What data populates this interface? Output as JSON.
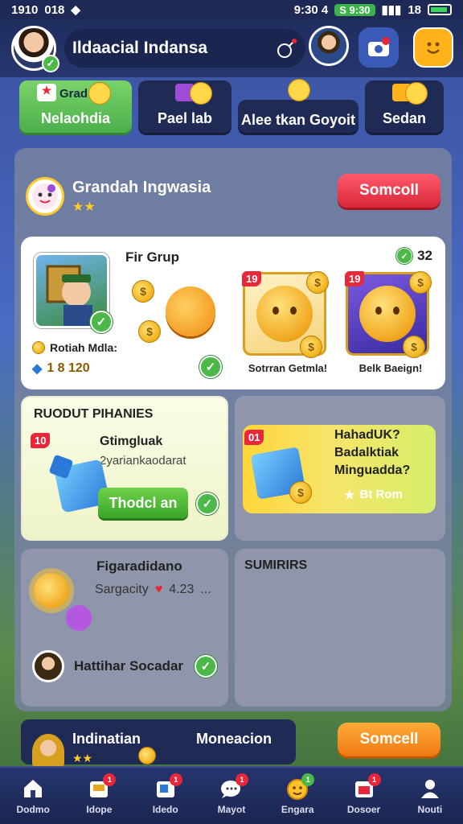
{
  "status_bar": {
    "left_time": "1910",
    "left_extra": "018",
    "center_clock": "9:30 4",
    "pill_text": "S 9:30",
    "right_extra": "18"
  },
  "header": {
    "username": "Ildaacial Indansa"
  },
  "tabs": [
    {
      "label": "Nelaohdia",
      "top_label": "Grad",
      "active": true
    },
    {
      "label": "Pael lab"
    },
    {
      "label": "Alee tkan Goyoit"
    },
    {
      "label": "Sedan"
    }
  ],
  "group": {
    "title": "Grandah Ingwasia",
    "stars": "★★",
    "action_label": "Somcoll"
  },
  "featured": {
    "title": "Fir Grup",
    "count": "32",
    "player_name": "Rotiah Mdla:",
    "player_stats": "1 8 120",
    "tiles": [
      {
        "badge": "19",
        "caption": "Sotrran Getmla!"
      },
      {
        "badge": "19",
        "caption": "Belk Baeign!"
      }
    ]
  },
  "challenge_left": {
    "title": "RUODUT PIHANIES",
    "badge": "10",
    "line1": "Gtimgluak",
    "line2": "2yariankaodarat",
    "button_label": "Thodcl an"
  },
  "challenge_right": {
    "badge": "01",
    "line1": "HahadUK?",
    "line2": "Badalktiak",
    "line3": "Minguadda?",
    "reward": "Bt Rom"
  },
  "social_left": {
    "title": "Figaradidano",
    "subtitle": "Sargacity",
    "score": "4.23",
    "more": "...",
    "friend_name": "Hattihar Socadar"
  },
  "social_right": {
    "title": "SUMIRIRS"
  },
  "bottom_strip": {
    "left_label": "Indinatian",
    "right_label": "Moneacion",
    "stars": "★★",
    "button_label": "Somcell"
  },
  "nav": [
    {
      "label": "Dodmo",
      "icon": "home-icon"
    },
    {
      "label": "Idope",
      "icon": "inbox-icon",
      "badge": "1"
    },
    {
      "label": "Idedo",
      "icon": "card-icon",
      "badge": "1"
    },
    {
      "label": "Mayot",
      "icon": "chat-icon",
      "badge": "1"
    },
    {
      "label": "Engara",
      "icon": "emoji-icon",
      "badge": "1"
    },
    {
      "label": "Dosoer",
      "icon": "gift-icon",
      "badge": "1"
    },
    {
      "label": "Nouti",
      "icon": "profile-icon"
    }
  ],
  "colors": {
    "accent_green": "#4cb848",
    "accent_red": "#e8283a",
    "accent_orange": "#f07810",
    "nav_bg": "#1a2550"
  }
}
